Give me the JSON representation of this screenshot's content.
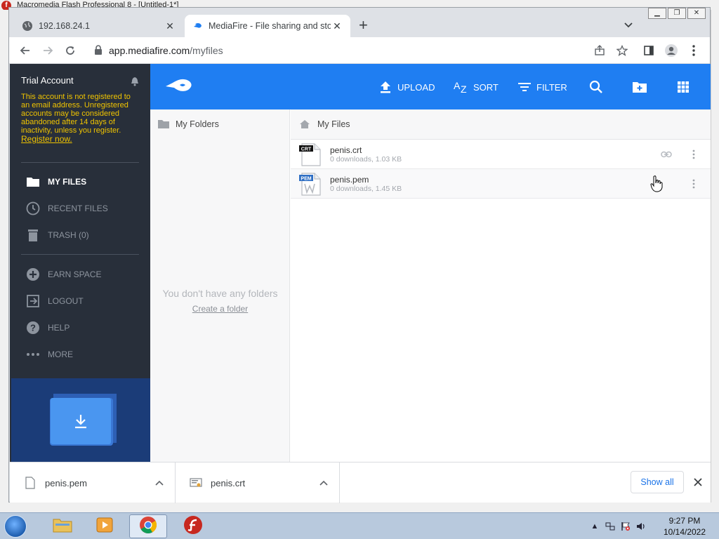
{
  "background_app": {
    "title": "Macromedia Flash Professional 8 - [Untitled-1*]"
  },
  "browser": {
    "tabs": [
      {
        "title": "192.168.24.1"
      },
      {
        "title": "MediaFire - File sharing and storage"
      }
    ],
    "url": {
      "host": "app.mediafire.com",
      "path": "/myfiles"
    }
  },
  "mediafire": {
    "sidebar": {
      "account_title": "Trial Account",
      "account_note": "This account is not registered to an email address. Unregistered accounts may be considered abandoned after 14 days of inactivity, unless you register.",
      "register_link": "Register now.",
      "nav": [
        {
          "label": "MY FILES",
          "icon": "folder-icon"
        },
        {
          "label": "RECENT FILES",
          "icon": "clock-icon"
        },
        {
          "label": "TRASH (0)",
          "icon": "trash-icon"
        },
        {
          "label": "EARN SPACE",
          "icon": "plus-circle-icon"
        },
        {
          "label": "LOGOUT",
          "icon": "logout-icon"
        },
        {
          "label": "HELP",
          "icon": "help-icon"
        },
        {
          "label": "MORE",
          "icon": "more-icon"
        }
      ]
    },
    "header": {
      "upload": "UPLOAD",
      "sort": "SORT",
      "filter": "FILTER"
    },
    "folders_pane": {
      "title": "My Folders",
      "empty_text": "You don't have any folders",
      "create_link": "Create a folder"
    },
    "files_pane": {
      "title": "My Files",
      "files": [
        {
          "name": "penis.crt",
          "meta": "0 downloads, 1.03 KB",
          "badge": "CRT"
        },
        {
          "name": "penis.pem",
          "meta": "0 downloads, 1.45 KB",
          "badge": "PEM"
        }
      ]
    }
  },
  "downloads": {
    "items": [
      {
        "name": "penis.pem"
      },
      {
        "name": "penis.crt"
      }
    ],
    "show_all": "Show all"
  },
  "taskbar": {
    "time": "9:27 PM",
    "date": "10/14/2022"
  },
  "colors": {
    "mf_blue": "#1f7ef2",
    "sidebar_bg": "#282f3a",
    "warning_yellow": "#f0c400"
  }
}
